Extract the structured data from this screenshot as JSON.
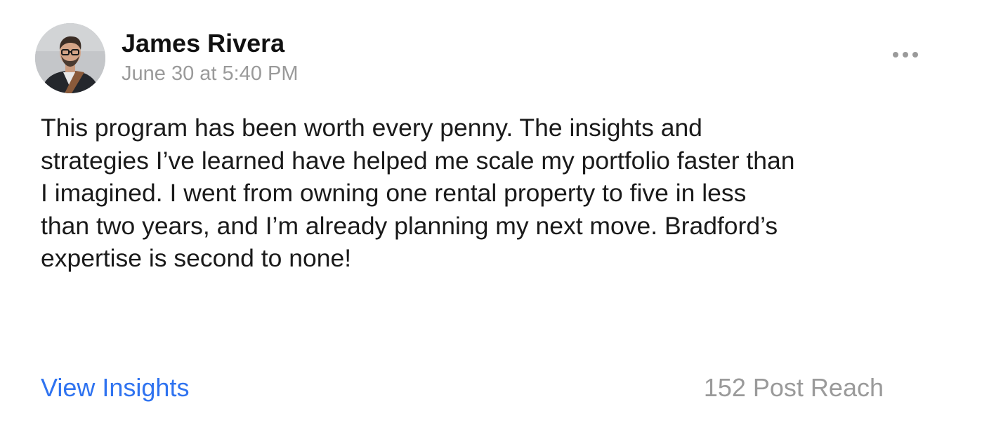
{
  "post": {
    "author": {
      "name": "James Rivera",
      "avatar_icon": "profile-photo"
    },
    "timestamp": "June 30 at 5:40 PM",
    "more_icon": "ellipsis-icon",
    "body_lines": [
      "This program has been worth every penny. The insights and",
      "strategies I’ve learned have helped me scale my portfolio faster than",
      "I imagined. I went from owning one rental property to five in less",
      "than two years, and I’m already planning my next move. Bradford’s",
      "expertise is second to none!"
    ]
  },
  "footer": {
    "view_insights_label": "View Insights",
    "post_reach": "152 Post Reach"
  },
  "colors": {
    "link": "#2f73f0",
    "muted": "#9a9a9a",
    "text": "#1a1a1a"
  }
}
